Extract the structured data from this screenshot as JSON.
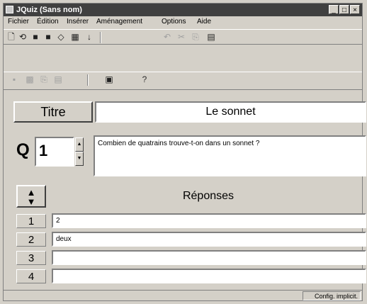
{
  "window": {
    "title": "JQuiz (Sans nom)",
    "controls": [
      "_",
      "□",
      "×"
    ]
  },
  "menu": [
    "Fichier",
    "Édition",
    "Insérer",
    "Aménagement",
    "Options",
    "Aide"
  ],
  "toolbar1_icons": [
    "new-icon",
    "open-icon",
    "save-icon",
    "save-as-icon",
    "erase-icon",
    "grid-icon",
    "pin-icon",
    "undo-icon",
    "cut-icon",
    "copy-icon",
    "paste-icon"
  ],
  "toolbar2_icons": [
    "export-icon",
    "config-icon",
    "copy-icon",
    "paste-icon",
    "web-icon",
    "help-icon"
  ],
  "toolbar2_glyphs": {
    "web": "▣",
    "help": "?"
  },
  "titre": {
    "label": "Titre",
    "value": "Le sonnet"
  },
  "question": {
    "letter": "Q",
    "number": "1",
    "text": "Combien de quatrains trouve-t-on dans un sonnet ?"
  },
  "responses": {
    "header": "Réponses",
    "items": [
      {
        "num": "1",
        "value": "2"
      },
      {
        "num": "2",
        "value": "deux"
      },
      {
        "num": "3",
        "value": ""
      },
      {
        "num": "4",
        "value": ""
      }
    ]
  },
  "status": {
    "text": "Config. implicit."
  }
}
